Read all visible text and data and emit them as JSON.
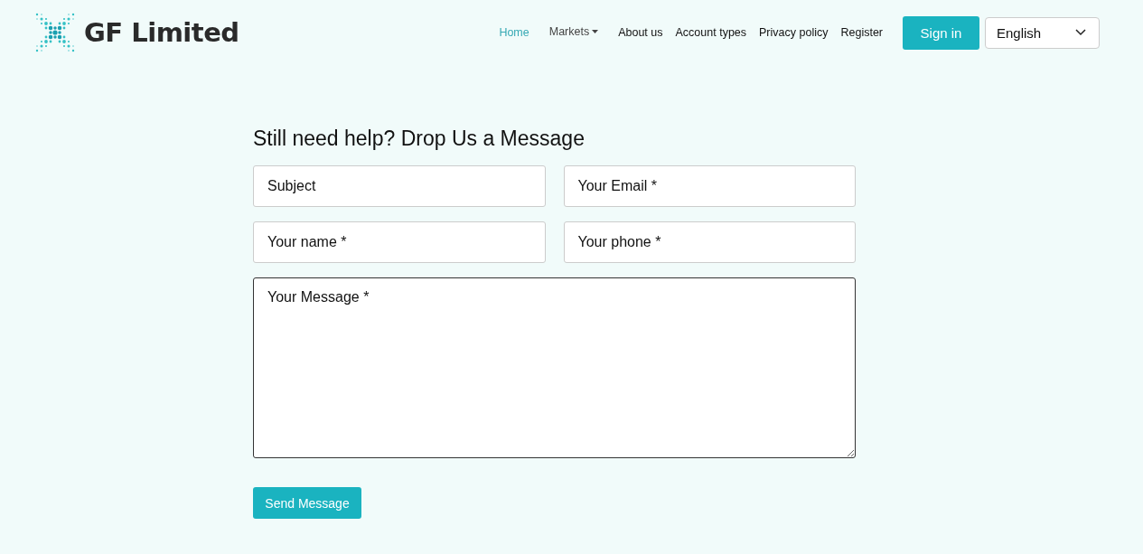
{
  "logo": {
    "text": "GF Limited"
  },
  "nav": [
    {
      "label": "Home",
      "kind": "link",
      "selected": true
    },
    {
      "label": "Markets",
      "kind": "dropdown",
      "selected": false
    },
    {
      "label": "About us",
      "kind": "link",
      "selected": false
    },
    {
      "label": "Account types",
      "kind": "link",
      "selected": false
    },
    {
      "label": "Privacy policy",
      "kind": "link",
      "selected": false
    },
    {
      "label": "Register",
      "kind": "link",
      "selected": false
    }
  ],
  "sign_in": "Sign in",
  "language": {
    "value": "English"
  },
  "form": {
    "title": "Still need help? Drop Us a Message",
    "fields": [
      {
        "placeholder": "Subject",
        "kind": "input"
      },
      {
        "placeholder": "Your Email *",
        "kind": "input"
      },
      {
        "placeholder": "Your name *",
        "kind": "input"
      },
      {
        "placeholder": "Your phone *",
        "kind": "input"
      },
      {
        "placeholder": "Your Message *",
        "kind": "textarea"
      }
    ],
    "submit": "Send Message"
  }
}
